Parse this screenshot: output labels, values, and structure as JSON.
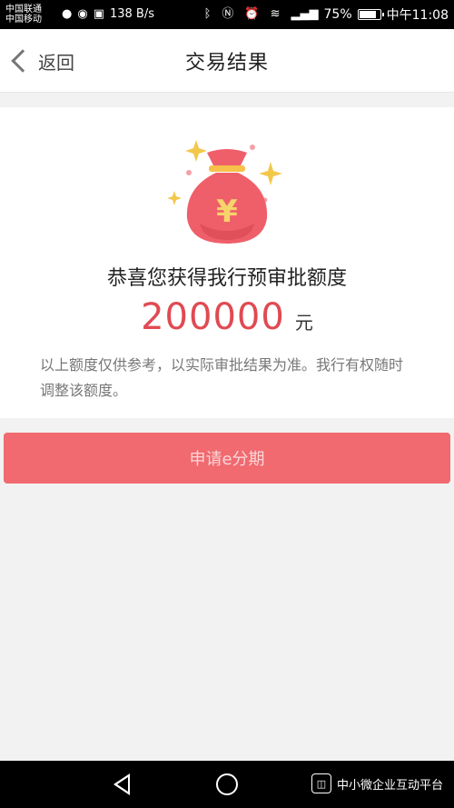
{
  "status_bar": {
    "carrier_1": "中国联通",
    "carrier_2": "中国移动",
    "speed": "138 B/s",
    "battery": "75%",
    "time": "中午11:08"
  },
  "header": {
    "back_label": "返回",
    "title": "交易结果"
  },
  "result": {
    "congrats": "恭喜您获得我行预审批额度",
    "amount": "200000",
    "unit": "元",
    "note": "以上额度仅供参考，以实际审批结果为准。我行有权随时调整该额度。"
  },
  "apply_button_label": "申请e分期",
  "watermark": "中小微企业互动平台",
  "colors": {
    "accent": "#f06a70",
    "amount_color": "#e04a52"
  }
}
